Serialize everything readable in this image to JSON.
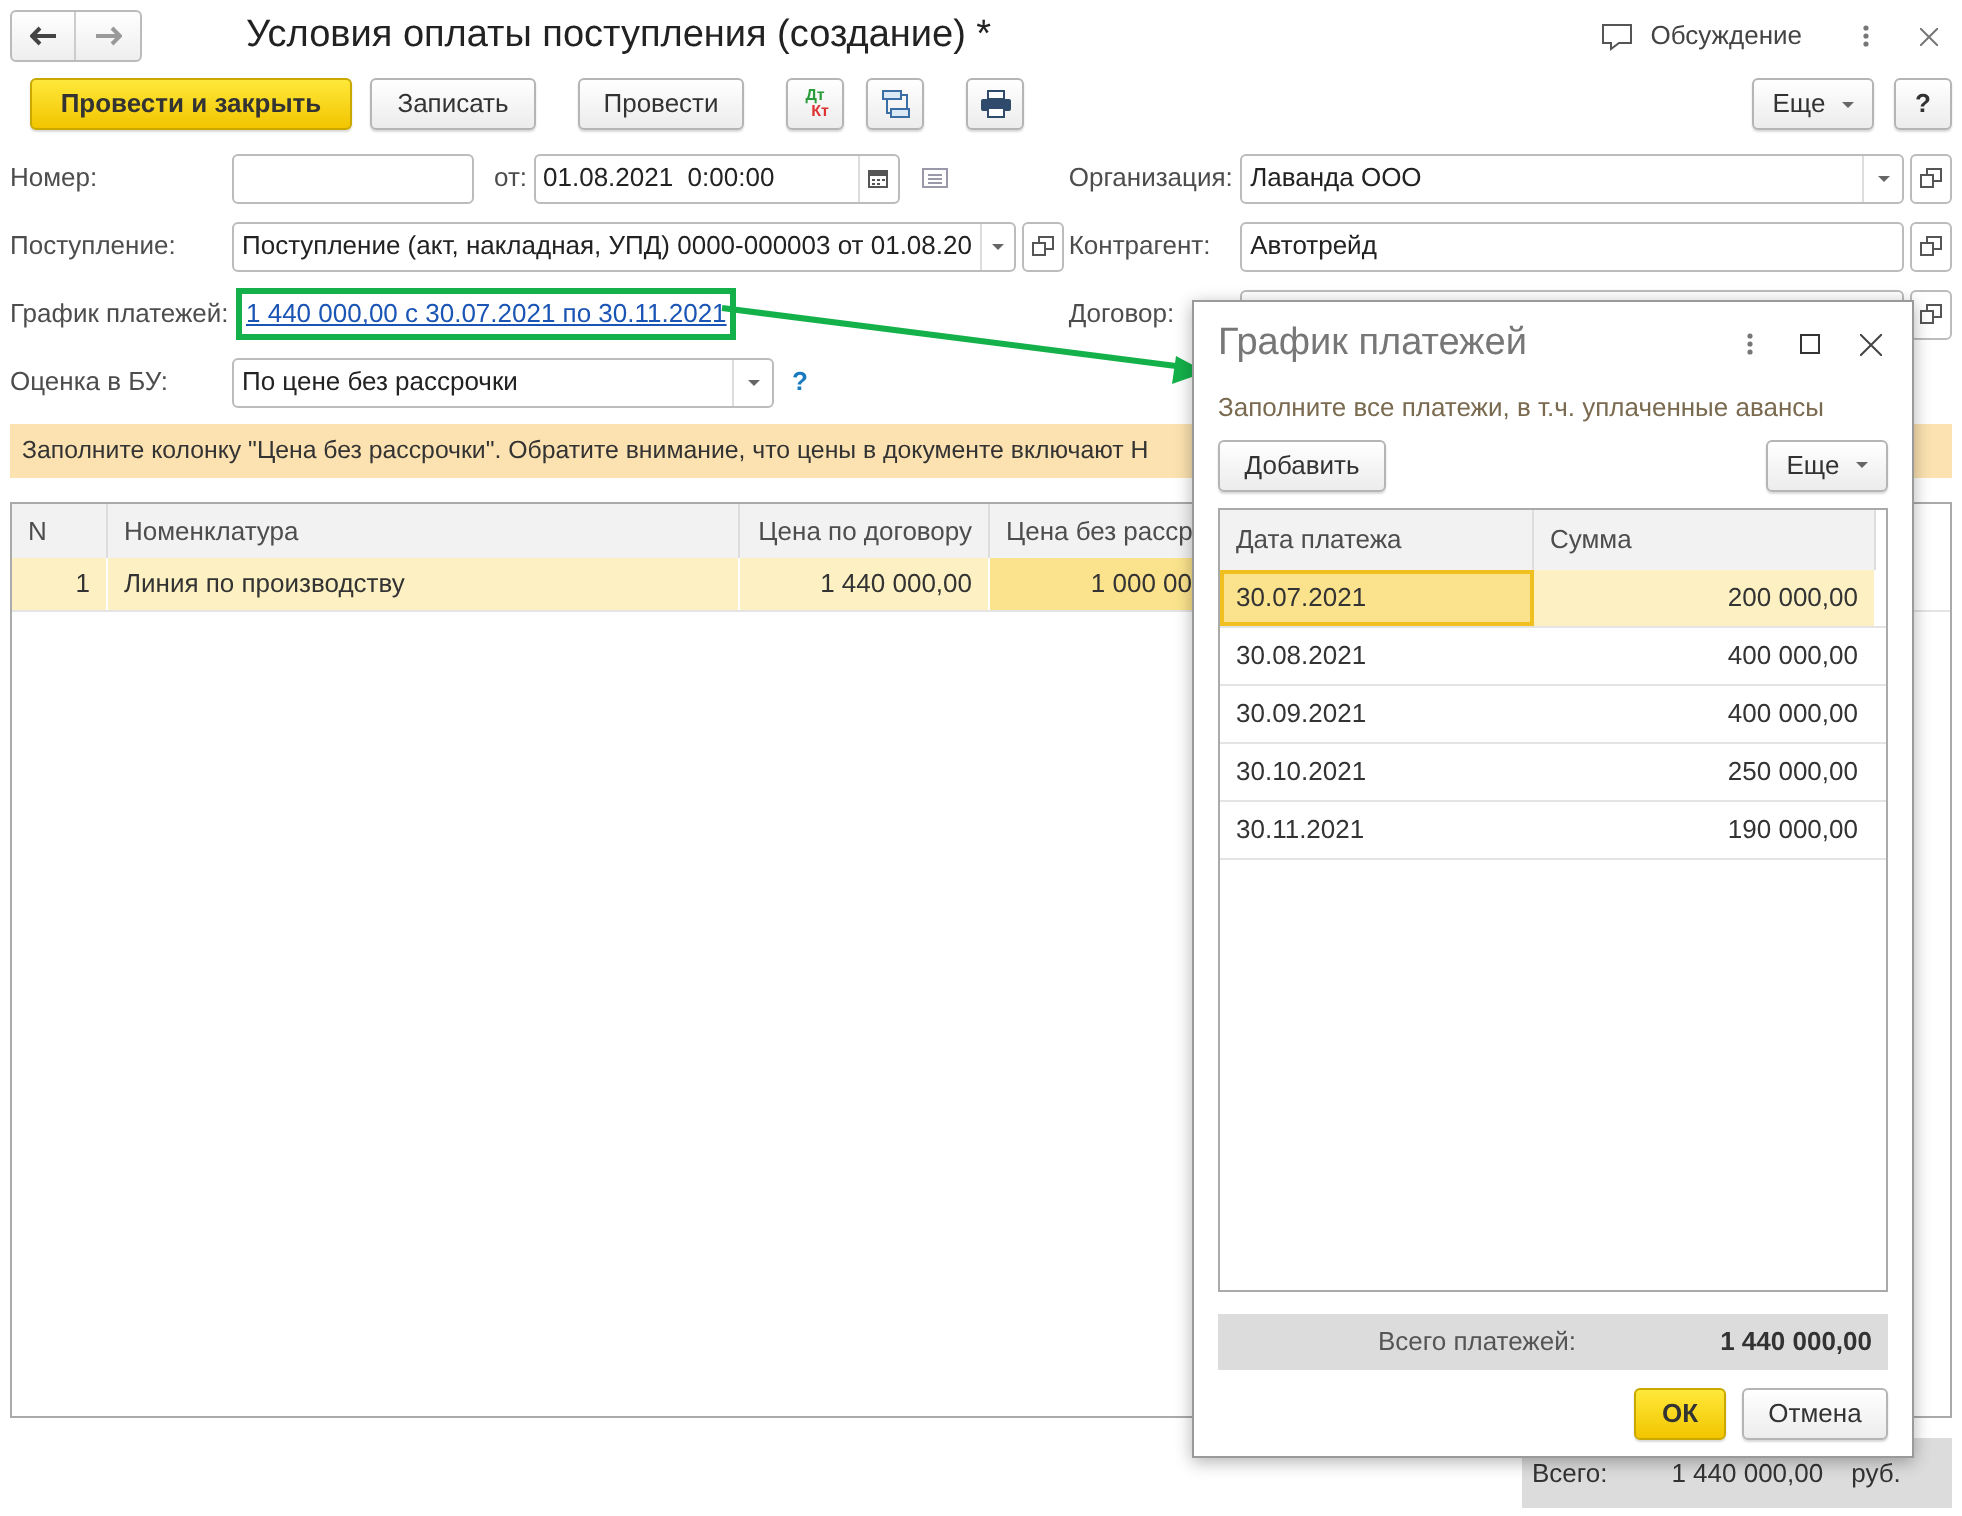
{
  "window": {
    "title": "Условия оплаты поступления (создание) *",
    "discussion": "Обсуждение"
  },
  "toolbar": {
    "buttons": [
      {
        "kind": "primary",
        "label": "Провести и закрыть"
      },
      {
        "kind": "plain",
        "label": "Записать"
      },
      {
        "kind": "plain",
        "label": "Провести"
      },
      {
        "kind": "dtkt",
        "top": "Дт",
        "bottom": "Кт"
      },
      {
        "kind": "structure"
      },
      {
        "kind": "print"
      }
    ],
    "more": "Еще",
    "help": "?"
  },
  "form": {
    "number_label": "Номер:",
    "date_label": "от:",
    "date": "01.08.2021  0:00:00",
    "organization": {
      "label": "Организация:",
      "value": "Лаванда ООО"
    },
    "receipt": {
      "label": "Поступление:",
      "value": "Поступление (акт, накладная, УПД) 0000-000003 от 01.08.20"
    },
    "counterparty": {
      "label": "Контрагент:",
      "value": "Автотрейд"
    },
    "schedule": {
      "label": "График платежей:",
      "link": "1 440 000,00 с 30.07.2021 по 30.11.2021"
    },
    "contract": {
      "label": "Договор:"
    },
    "valuation": {
      "label": "Оценка в БУ:",
      "value": "По цене без рассрочки",
      "help": "?"
    }
  },
  "warning": "Заполните колонку \"Цена без рассрочки\". Обратите внимание, что цены в документе включают Н",
  "table": {
    "columns": [
      "N",
      "Номенклатура",
      "Цена по договору",
      "Цена без расср"
    ],
    "rows": [
      {
        "cells": [
          "1",
          "Линия по производству",
          "1 440 000,00",
          "1 000 00"
        ],
        "selected": true
      }
    ]
  },
  "totals": {
    "label": "Всего:",
    "value": "1 440 000,00",
    "currency": "руб."
  },
  "dialog": {
    "title": "График платежей",
    "hint": "Заполните все платежи, в т.ч. уплаченные авансы",
    "add": "Добавить",
    "more": "Еще",
    "columns": [
      "Дата платежа",
      "Сумма"
    ],
    "rows": [
      {
        "date": "30.07.2021",
        "amount": "200 000,00",
        "selected": true
      },
      {
        "date": "30.08.2021",
        "amount": "400 000,00",
        "selected": false
      },
      {
        "date": "30.09.2021",
        "amount": "400 000,00",
        "selected": false
      },
      {
        "date": "30.10.2021",
        "amount": "250 000,00",
        "selected": false
      },
      {
        "date": "30.11.2021",
        "amount": "190 000,00",
        "selected": false
      }
    ],
    "total_label": "Всего платежей:",
    "total": "1 440 000,00",
    "ok": "ОК",
    "cancel": "Отмена"
  }
}
